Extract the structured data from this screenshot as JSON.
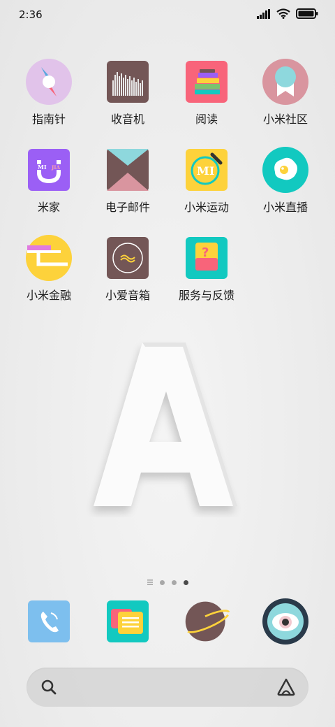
{
  "status_bar": {
    "time": "2:36"
  },
  "apps": [
    {
      "label": "指南针",
      "icon": "compass-icon"
    },
    {
      "label": "收音机",
      "icon": "radio-icon"
    },
    {
      "label": "阅读",
      "icon": "books-icon"
    },
    {
      "label": "小米社区",
      "icon": "community-icon"
    },
    {
      "label": "米家",
      "icon": "mijia-icon"
    },
    {
      "label": "电子邮件",
      "icon": "email-icon"
    },
    {
      "label": "小米运动",
      "icon": "mi-fit-icon"
    },
    {
      "label": "小米直播",
      "icon": "live-icon"
    },
    {
      "label": "小米金融",
      "icon": "finance-icon"
    },
    {
      "label": "小爱音箱",
      "icon": "speaker-icon"
    },
    {
      "label": "服务与反馈",
      "icon": "feedback-icon"
    }
  ],
  "page_indicator": {
    "pages": 3,
    "active": 3
  },
  "dock": [
    {
      "name": "phone",
      "icon": "phone-icon"
    },
    {
      "name": "messages",
      "icon": "messages-icon"
    },
    {
      "name": "browser",
      "icon": "planet-icon"
    },
    {
      "name": "camera",
      "icon": "camera-icon"
    }
  ],
  "search": {
    "icon": "search-icon",
    "assistant_icon": "assistant-icon"
  },
  "colors": {
    "purple": "#9b5ff5",
    "teal": "#12c9c0",
    "yellow": "#fdd23b",
    "pink": "#f8647a",
    "brown": "#735656"
  }
}
